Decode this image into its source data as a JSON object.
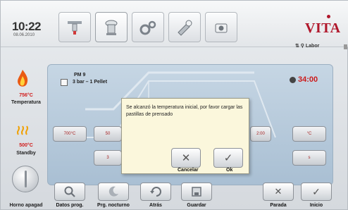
{
  "header": {
    "time": "10:22",
    "date": "08.06.2010",
    "brand": "VITA",
    "profile": "Labor",
    "tabs": [
      {
        "icon": "furnace-icon"
      },
      {
        "icon": "press-icon"
      },
      {
        "icon": "settings-gears-icon"
      },
      {
        "icon": "tools-icon"
      },
      {
        "icon": "camera-icon"
      }
    ]
  },
  "sidebar": {
    "temperature_value": "756°C",
    "temperature_label": "Temperatura",
    "standby_value": "500°C",
    "standby_label": "Standby",
    "power_label": "Horno apagad"
  },
  "program": {
    "name": "PM 9",
    "detail": "3 bar – 1 Pellet",
    "remaining_time": "34:00"
  },
  "chart_controls": {
    "temp_button": "700°C",
    "step_button_a": "50",
    "step_button_b": "3",
    "step_button_c": "2:00",
    "right_top": "°C",
    "right_bottom": "s"
  },
  "dialog": {
    "message": "Se alcanzó la temperatura inicial, por favor cargar las pastillas de prensado",
    "cancel_label": "Cancelar",
    "ok_label": "Ok"
  },
  "toolbar": {
    "datos_prog": "Datos prog.",
    "prg_nocturno": "Prg. nocturno",
    "atras": "Atrás",
    "guardar": "Guardar",
    "parada": "Parada",
    "inicio": "Inicio"
  },
  "colors": {
    "accent_red": "#d11a1a",
    "brand_red": "#b0172b",
    "dialog_bg": "#fbf7dc",
    "main_bg": "#b8cbdc"
  }
}
